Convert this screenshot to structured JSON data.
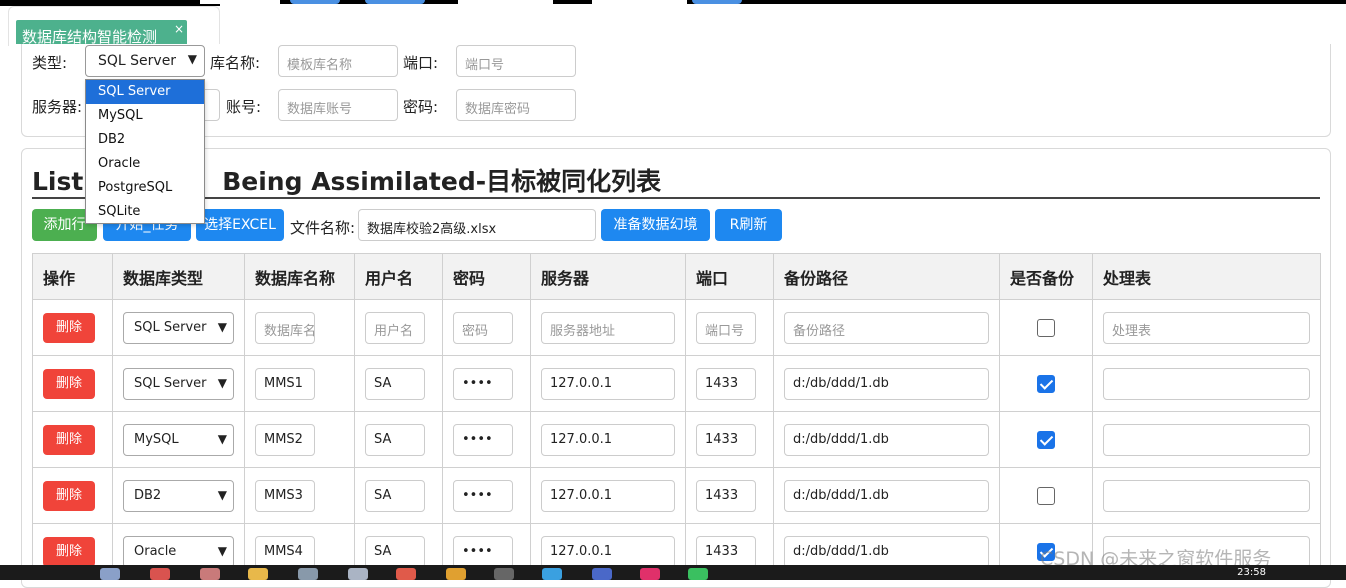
{
  "tab": {
    "title": "数据库结构智能检测",
    "close": "×"
  },
  "search": {
    "type_label": "类型:",
    "type_value": "SQL Server",
    "lib_label": "库名称:",
    "lib_placeholder": "模板库名称",
    "port_label": "端口:",
    "port_placeholder": "端口号",
    "server_label": "服务器:",
    "account_label": "账号:",
    "account_placeholder": "数据库账号",
    "pwd_label": "密码:",
    "pwd_placeholder": "数据库密码",
    "type_options": [
      "SQL Server",
      "MySQL",
      "DB2",
      "Oracle",
      "PostgreSQL",
      "SQLite"
    ]
  },
  "list": {
    "title_left": "List o",
    "title_right": "Being Assimilated-目标被同化列表",
    "add_row": "添加行",
    "start_task": "开始_任务",
    "select_excel": "选择EXCEL",
    "file_label": "文件名称:",
    "file_value": "数据库校验2高级.xlsx",
    "prepare": "准备数据幻境",
    "refresh": "R刷新"
  },
  "table": {
    "headers": [
      "操作",
      "数据库类型",
      "数据库名称",
      "用户名",
      "密码",
      "服务器",
      "端口",
      "备份路径",
      "是否备份",
      "处理表"
    ],
    "delete_label": "删除",
    "placeholder_row": {
      "type": "SQL Server",
      "db": "数据库名称",
      "user": "用户名",
      "pwd": "密码",
      "server": "服务器地址",
      "port": "端口号",
      "backup": "备份路径",
      "table": "处理表"
    },
    "rows": [
      {
        "type": "SQL Server",
        "db": "MMS1",
        "user": "SA",
        "pwd": "••••",
        "server": "127.0.0.1",
        "port": "1433",
        "backup": "d:/db/ddd/1.db",
        "checked": true
      },
      {
        "type": "MySQL",
        "db": "MMS2",
        "user": "SA",
        "pwd": "••••",
        "server": "127.0.0.1",
        "port": "1433",
        "backup": "d:/db/ddd/1.db",
        "checked": true
      },
      {
        "type": "DB2",
        "db": "MMS3",
        "user": "SA",
        "pwd": "••••",
        "server": "127.0.0.1",
        "port": "1433",
        "backup": "d:/db/ddd/1.db",
        "checked": false
      },
      {
        "type": "Oracle",
        "db": "MMS4",
        "user": "SA",
        "pwd": "••••",
        "server": "127.0.0.1",
        "port": "1433",
        "backup": "d:/db/ddd/1.db",
        "checked": true
      }
    ]
  },
  "taskbar": {
    "time": "23:58"
  },
  "watermark": "CSDN @未来之窗软件服务",
  "colors": {
    "tab": "#4db18d",
    "primary": "#1e88f0",
    "success": "#4caf50",
    "danger": "#f0443a"
  }
}
